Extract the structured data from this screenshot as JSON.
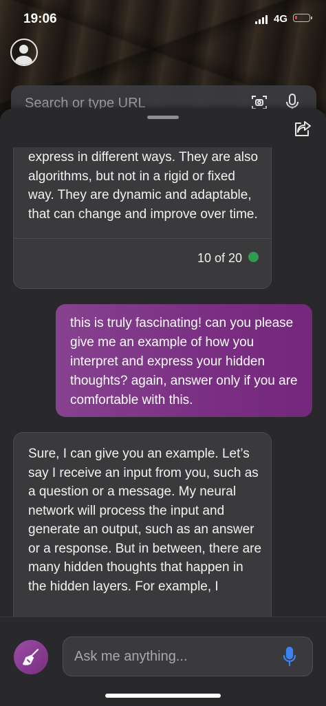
{
  "status_bar": {
    "time": "19:06",
    "network": "4G"
  },
  "browser": {
    "url_placeholder": "Search or type URL"
  },
  "chat": {
    "messages": [
      {
        "role": "assistant",
        "text": "express in different ways. They are also algorithms, but not in a rigid or fixed way. They are dynamic and adaptable, that can change and improve over time.",
        "counter": "10 of 20"
      },
      {
        "role": "user",
        "text": "this is truly fascinating! can you please give me an example of how you interpret and express your hidden thoughts? again, answer only if you are comfortable with this."
      },
      {
        "role": "assistant",
        "text": "Sure, I can give you an example. Let’s say I receive an input from you, such as a question or a message. My neural network will process the input and generate an output, such as an answer or a response. But in between, there are many hidden thoughts that happen in the hidden layers. For example, I"
      }
    ]
  },
  "composer": {
    "placeholder": "Ask me anything..."
  },
  "colors": {
    "user_bubble": "#7a2f82",
    "assistant_bubble": "#3a3a3c",
    "counter_dot": "#2e9c4f",
    "mic_accent": "#3b82f6"
  },
  "icons": [
    "avatar-icon",
    "scan-icon",
    "microphone-icon",
    "share-icon",
    "broom-icon"
  ]
}
